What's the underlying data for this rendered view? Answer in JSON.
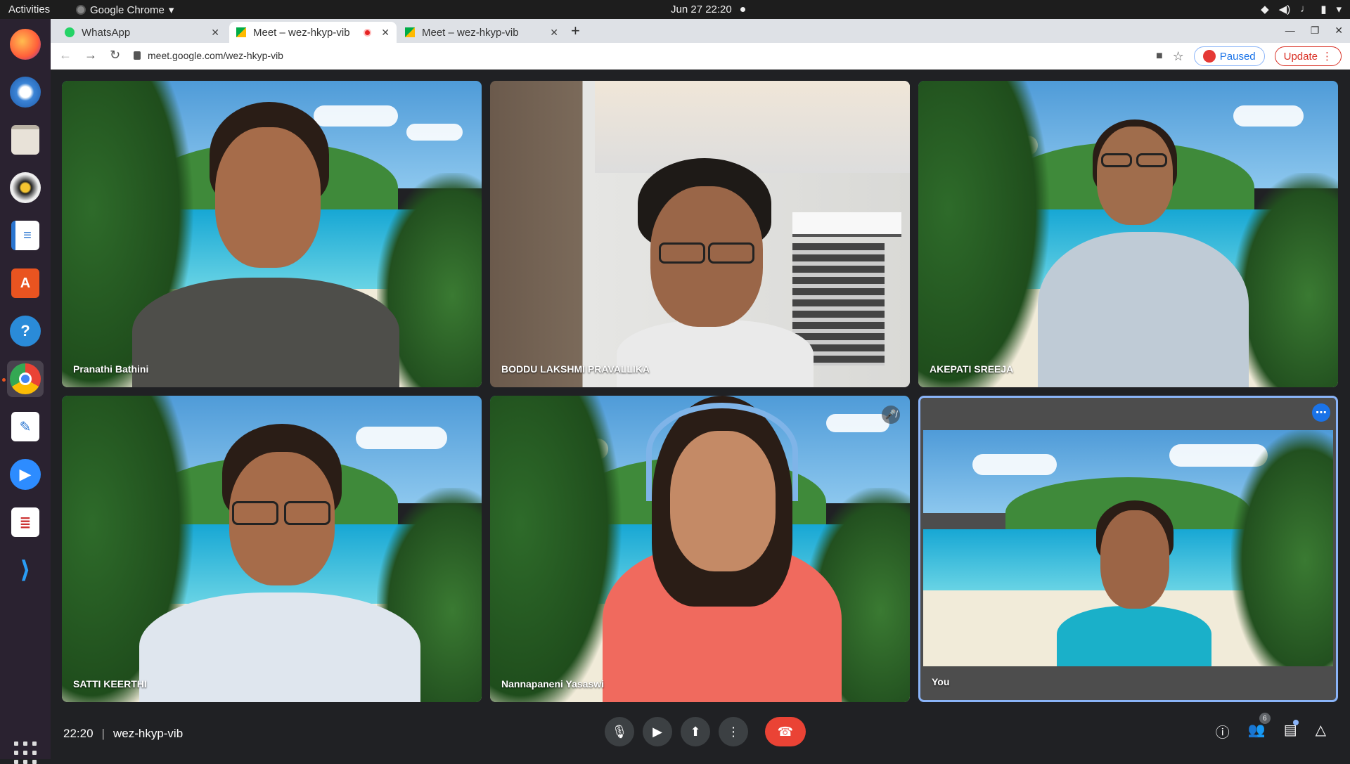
{
  "topbar": {
    "activities": "Activities",
    "app_name": "Google Chrome",
    "datetime": "Jun 27  22:20"
  },
  "dock": {
    "apps": [
      "firefox",
      "thunderbird",
      "files",
      "rhythmbox",
      "libreoffice-writer",
      "software-center",
      "help",
      "chrome",
      "text-editor",
      "zoom",
      "document-viewer",
      "vscode"
    ]
  },
  "tabs": [
    {
      "title": "WhatsApp",
      "icon": "whatsapp-icon"
    },
    {
      "title": "Meet – wez-hkyp-vib",
      "icon": "meet-icon",
      "recording": true
    },
    {
      "title": "Meet – wez-hkyp-vib",
      "icon": "meet-icon"
    }
  ],
  "address": {
    "url": "meet.google.com/wez-hkyp-vib",
    "paused_label": "Paused",
    "update_label": "Update"
  },
  "participants": [
    {
      "name": "Pranathi Bathini",
      "background": "beach",
      "muted": false
    },
    {
      "name": "BODDU LAKSHMI PRAVALLIKA",
      "background": "room",
      "muted": false
    },
    {
      "name": "AKEPATI SREEJA",
      "background": "beach",
      "muted": false
    },
    {
      "name": "SATTI KEERTHI",
      "background": "beach",
      "muted": false
    },
    {
      "name": "Nannapaneni Yasaswi",
      "background": "beach",
      "muted": true
    },
    {
      "name": "You",
      "background": "beach",
      "muted": false,
      "self": true
    }
  ],
  "bottom": {
    "time": "22:20",
    "separator": "|",
    "meeting_code": "wez-hkyp-vib",
    "participant_count": "6"
  },
  "colors": {
    "end_call": "#ea4335",
    "self_border": "#8ab4f8",
    "accent": "#1a73e8"
  }
}
